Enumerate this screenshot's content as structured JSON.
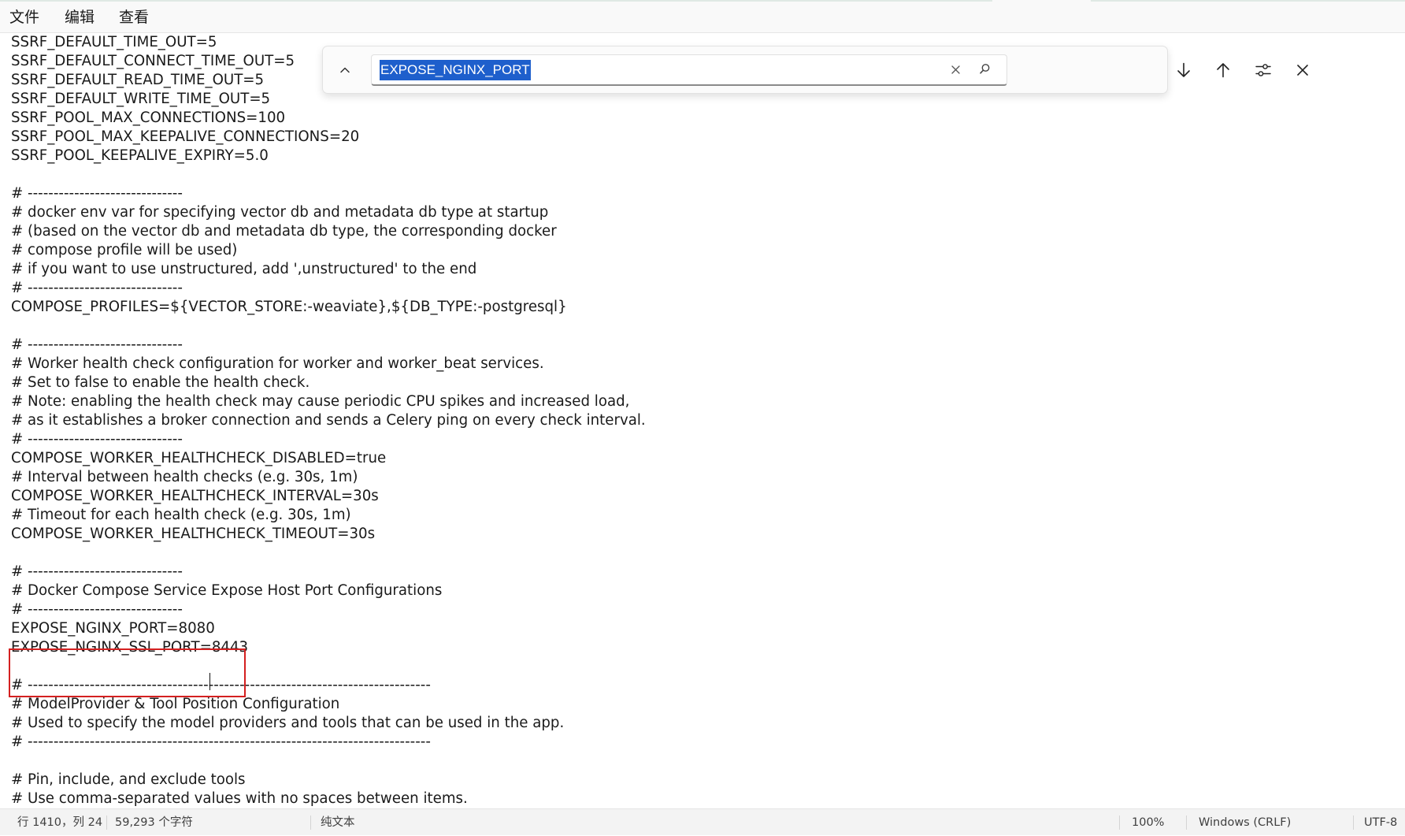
{
  "menu": {
    "file": "文件",
    "edit": "编辑",
    "view": "查看"
  },
  "editor": {
    "lines": [
      "SSRF_DEFAULT_TIME_OUT=5",
      "SSRF_DEFAULT_CONNECT_TIME_OUT=5",
      "SSRF_DEFAULT_READ_TIME_OUT=5",
      "SSRF_DEFAULT_WRITE_TIME_OUT=5",
      "SSRF_POOL_MAX_CONNECTIONS=100",
      "SSRF_POOL_MAX_KEEPALIVE_CONNECTIONS=20",
      "SSRF_POOL_KEEPALIVE_EXPIRY=5.0",
      "",
      "# ------------------------------",
      "# docker env var for specifying vector db and metadata db type at startup",
      "# (based on the vector db and metadata db type, the corresponding docker",
      "# compose profile will be used)",
      "# if you want to use unstructured, add ',unstructured' to the end",
      "# ------------------------------",
      "COMPOSE_PROFILES=${VECTOR_STORE:-weaviate},${DB_TYPE:-postgresql}",
      "",
      "# ------------------------------",
      "# Worker health check configuration for worker and worker_beat services.",
      "# Set to false to enable the health check.",
      "# Note: enabling the health check may cause periodic CPU spikes and increased load,",
      "# as it establishes a broker connection and sends a Celery ping on every check interval.",
      "# ------------------------------",
      "COMPOSE_WORKER_HEALTHCHECK_DISABLED=true",
      "# Interval between health checks (e.g. 30s, 1m)",
      "COMPOSE_WORKER_HEALTHCHECK_INTERVAL=30s",
      "# Timeout for each health check (e.g. 30s, 1m)",
      "COMPOSE_WORKER_HEALTHCHECK_TIMEOUT=30s",
      "",
      "# ------------------------------",
      "# Docker Compose Service Expose Host Port Configurations",
      "# ------------------------------",
      "EXPOSE_NGINX_PORT=8080",
      "EXPOSE_NGINX_SSL_PORT=8443",
      "",
      "# ------------------------------------------------------------------------------",
      "# ModelProvider & Tool Position Configuration",
      "# Used to specify the model providers and tools that can be used in the app.",
      "# ------------------------------------------------------------------------------",
      "",
      "# Pin, include, and exclude tools",
      "# Use comma-separated values with no spaces between items."
    ]
  },
  "find": {
    "query": "EXPOSE_NGINX_PORT"
  },
  "status": {
    "position": "行 1410，列 24",
    "chars": "59,293 个字符",
    "type": "纯文本",
    "zoom": "100%",
    "eol": "Windows (CRLF)",
    "encoding": "UTF-8"
  }
}
